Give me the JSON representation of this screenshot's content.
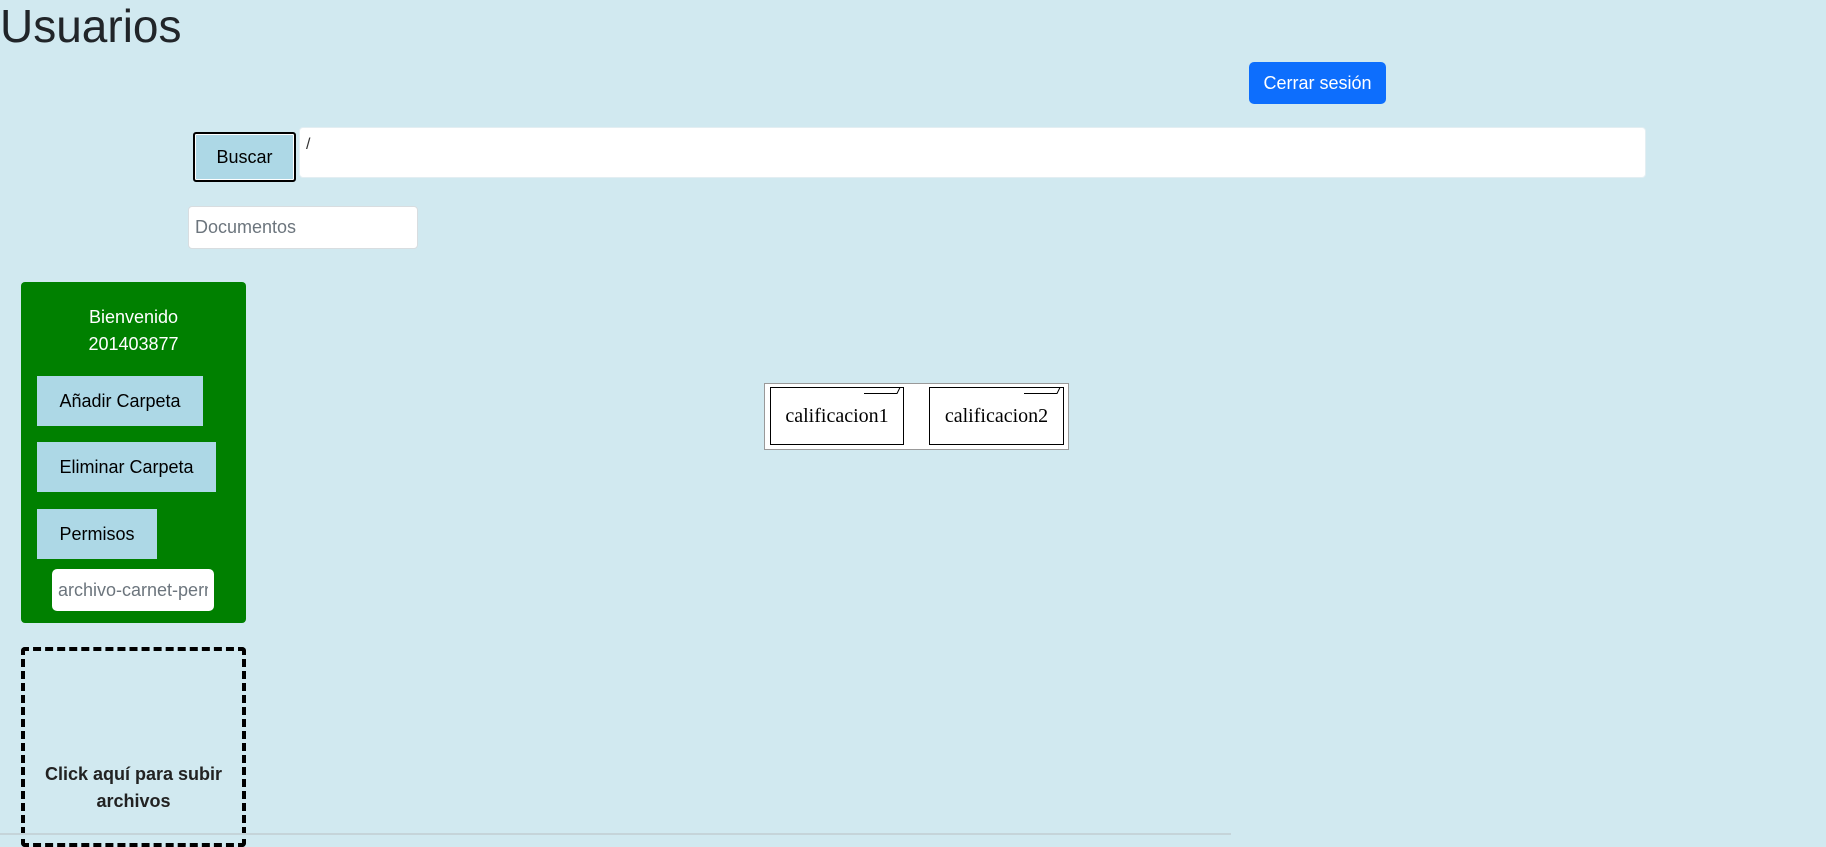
{
  "header": {
    "title": "Usuarios",
    "logout_label": "Cerrar sesión"
  },
  "search": {
    "button_label": "Buscar",
    "path_value": "/",
    "docs_placeholder": "Documentos"
  },
  "sidebar": {
    "welcome_line1": "Bienvenido",
    "welcome_line2": "201403877",
    "buttons": [
      {
        "label": "Añadir Carpeta"
      },
      {
        "label": "Eliminar Carpeta"
      },
      {
        "label": "Permisos"
      }
    ],
    "permission_placeholder": "archivo-carnet-permiso"
  },
  "upload": {
    "text": "Click aquí para subir archivos"
  },
  "folders": [
    {
      "name": "calificacion1"
    },
    {
      "name": "calificacion2"
    }
  ],
  "colors": {
    "background": "#d1e9f0",
    "sidebar": "#008000",
    "side_button": "#add8e6",
    "primary": "#0d6efd"
  }
}
